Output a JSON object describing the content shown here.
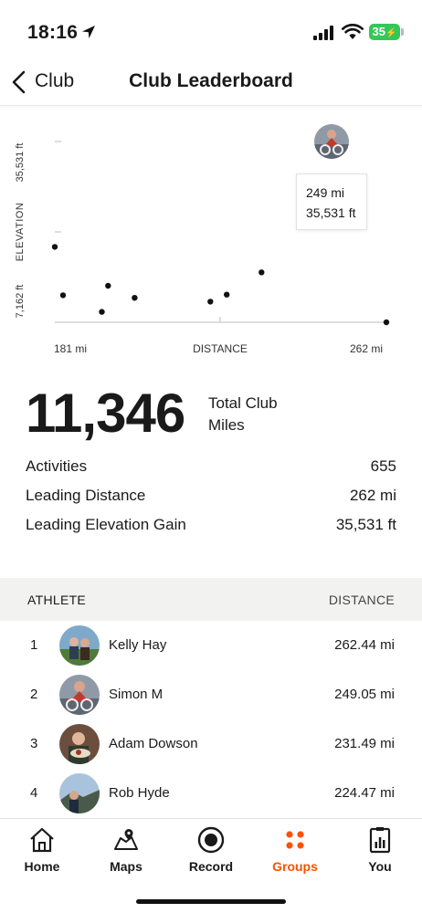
{
  "status_bar": {
    "time": "18:16",
    "battery": "35"
  },
  "header": {
    "back_label": "Club",
    "title": "Club Leaderboard"
  },
  "chart_data": {
    "type": "scatter",
    "xlabel": "DISTANCE",
    "ylabel": "ELEVATION",
    "x_tick_labels": [
      "181 mi",
      "262 mi"
    ],
    "y_tick_labels": [
      "7,162 ft",
      "35,531 ft"
    ],
    "xlim": [
      181,
      262
    ],
    "ylim": [
      7162,
      35531
    ],
    "points": [
      {
        "x": 181,
        "y": 19000
      },
      {
        "x": 183,
        "y": 11400
      },
      {
        "x": 192.5,
        "y": 8800
      },
      {
        "x": 194,
        "y": 12900
      },
      {
        "x": 200.5,
        "y": 11000
      },
      {
        "x": 219,
        "y": 10400
      },
      {
        "x": 223,
        "y": 11500
      },
      {
        "x": 231.5,
        "y": 15000
      },
      {
        "x": 249,
        "y": 35531
      },
      {
        "x": 262,
        "y": 7162
      }
    ],
    "highlight": {
      "distance": "249 mi",
      "elevation": "35,531 ft"
    }
  },
  "summary": {
    "total_value": "11,346",
    "total_label": "Total Club Miles"
  },
  "stats": [
    {
      "label": "Activities",
      "value": "655"
    },
    {
      "label": "Leading Distance",
      "value": "262 mi"
    },
    {
      "label": "Leading Elevation Gain",
      "value": "35,531 ft"
    }
  ],
  "table": {
    "col_athlete": "ATHLETE",
    "col_distance": "DISTANCE",
    "rows": [
      {
        "rank": "1",
        "name": "Kelly Hay",
        "distance": "262.44 mi"
      },
      {
        "rank": "2",
        "name": "Simon M",
        "distance": "249.05 mi"
      },
      {
        "rank": "3",
        "name": "Adam Dowson",
        "distance": "231.49 mi"
      },
      {
        "rank": "4",
        "name": "Rob Hyde",
        "distance": "224.47 mi"
      }
    ]
  },
  "tabbar": {
    "items": [
      {
        "label": "Home",
        "icon": "home-icon"
      },
      {
        "label": "Maps",
        "icon": "maps-icon"
      },
      {
        "label": "Record",
        "icon": "record-icon"
      },
      {
        "label": "Groups",
        "icon": "groups-icon"
      },
      {
        "label": "You",
        "icon": "you-icon"
      }
    ],
    "active": "Groups"
  },
  "colors": {
    "accent": "#fc5200",
    "battery": "#34c759",
    "text": "#1a1a1a",
    "table_header_bg": "#f2f2f1"
  }
}
